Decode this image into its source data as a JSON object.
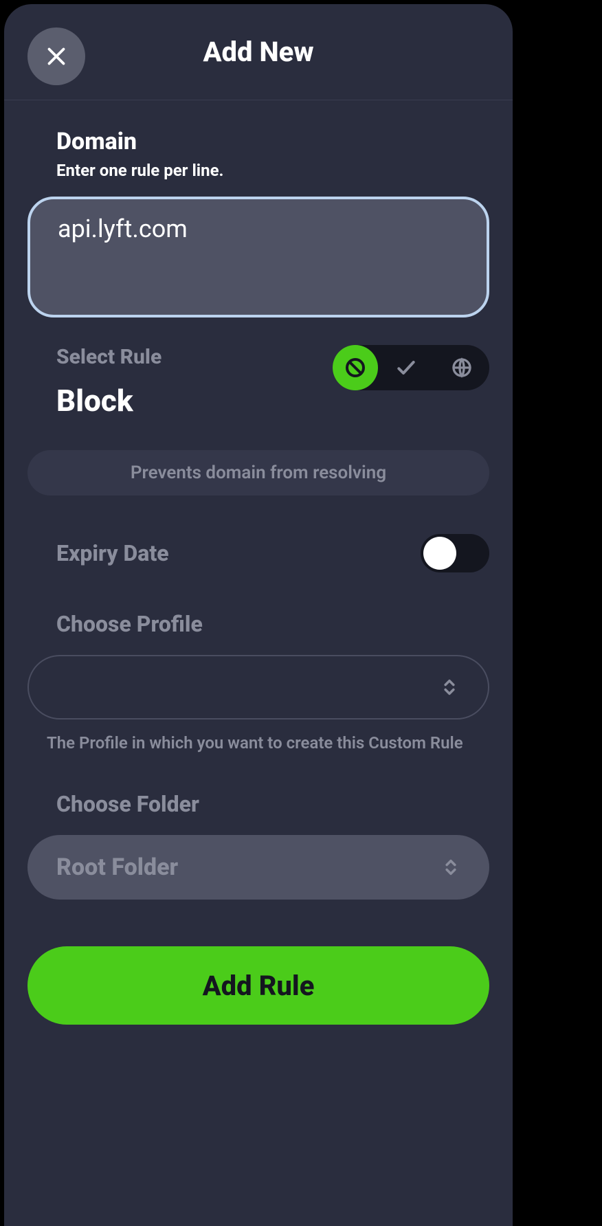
{
  "header": {
    "title": "Add New"
  },
  "domain": {
    "label": "Domain",
    "hint": "Enter one rule per line.",
    "value": "api.lyft.com"
  },
  "selectRule": {
    "label": "Select Rule",
    "value": "Block",
    "description": "Prevents domain from resolving"
  },
  "expiry": {
    "label": "Expiry Date",
    "enabled": false
  },
  "profile": {
    "label": "Choose Profile",
    "value": "",
    "helper": "The Profile in which you want to create this Custom Rule"
  },
  "folder": {
    "label": "Choose Folder",
    "value": "Root Folder"
  },
  "submit": {
    "label": "Add Rule"
  }
}
